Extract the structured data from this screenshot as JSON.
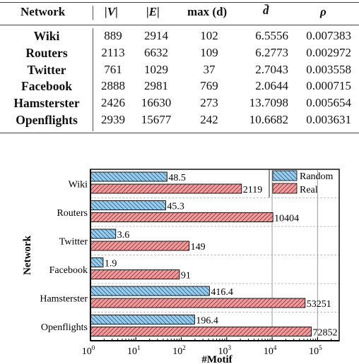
{
  "table": {
    "headers": [
      "Network",
      "|V|",
      "|E|",
      "max (d)",
      "d̄",
      "ρ"
    ],
    "rows": [
      {
        "network": "Wiki",
        "V": "889",
        "E": "2914",
        "maxd": "102",
        "dbar": "6.5556",
        "rho": "0.007383"
      },
      {
        "network": "Routers",
        "V": "2113",
        "E": "6632",
        "maxd": "109",
        "dbar": "6.2773",
        "rho": "0.002972"
      },
      {
        "network": "Twitter",
        "V": "761",
        "E": "1029",
        "maxd": "37",
        "dbar": "2.7043",
        "rho": "0.003558"
      },
      {
        "network": "Facebook",
        "V": "2888",
        "E": "2981",
        "maxd": "769",
        "dbar": "2.0644",
        "rho": "0.000715"
      },
      {
        "network": "Hamsterster",
        "V": "2426",
        "E": "16630",
        "maxd": "273",
        "dbar": "13.7098",
        "rho": "0.005654"
      },
      {
        "network": "Openflights",
        "V": "2939",
        "E": "15677",
        "maxd": "242",
        "dbar": "10.6682",
        "rho": "0.003631"
      }
    ]
  },
  "chart_data": {
    "type": "bar",
    "orientation": "horizontal",
    "xscale": "log",
    "categories": [
      "Wiki",
      "Routers",
      "Twitter",
      "Facebook",
      "Hamsterster",
      "Openflights"
    ],
    "series": [
      {
        "name": "Random",
        "color": "#8fcdf3",
        "hatch": "backslash",
        "values": [
          48.5,
          45.3,
          3.6,
          1.9,
          416.4,
          196.4
        ],
        "labels": [
          "48.5",
          "45.3",
          "3.6",
          "1.9",
          "416.4",
          "196.4"
        ]
      },
      {
        "name": "Real",
        "color": "#f0999b",
        "hatch": "slash",
        "values": [
          2119,
          10404,
          149,
          91,
          53251,
          72852
        ],
        "labels": [
          "2119",
          "10404",
          "149",
          "91",
          "53251",
          "72852"
        ]
      }
    ],
    "title": "",
    "xlabel": "#Motif",
    "ylabel": "Network",
    "xlim": [
      1,
      300000
    ],
    "xticks": [
      1,
      10,
      100,
      1000,
      10000,
      100000
    ],
    "xtick_bases": [
      "10",
      "10",
      "10",
      "10",
      "10",
      "10"
    ],
    "xtick_exps": [
      "0",
      "1",
      "2",
      "3",
      "4",
      "5"
    ],
    "vlines": [
      10000,
      100000
    ],
    "grid": "horizontal dashed between groups",
    "legend": "top-right"
  }
}
